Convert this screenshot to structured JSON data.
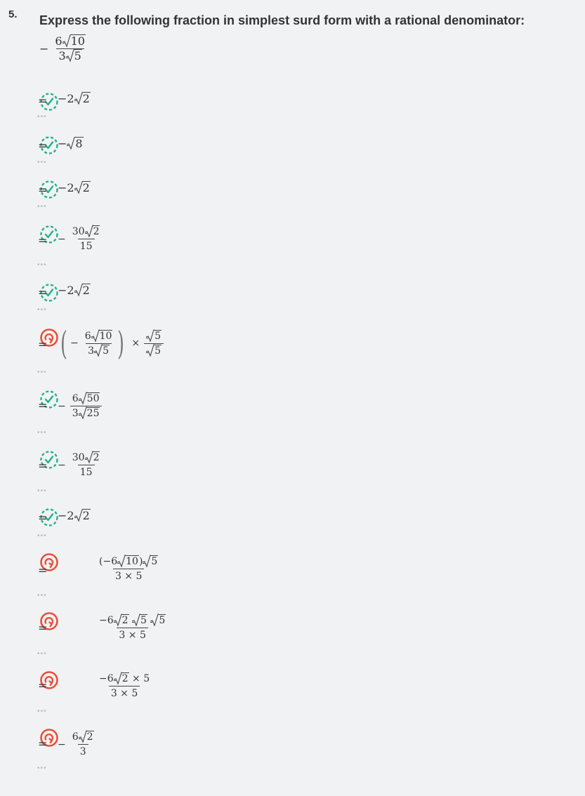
{
  "question": {
    "number": "5.",
    "prompt": "Express the following fraction in simplest surd form with a rational denominator:",
    "expression": {
      "sign": "−",
      "num_coef": "6",
      "num_rad": "10",
      "den_coef": "3",
      "den_rad": "5"
    }
  },
  "colors": {
    "correct": "#21b28c",
    "incorrect": "#e8503a",
    "background": "#f1f2f4"
  },
  "steps": [
    {
      "status": "correct",
      "icon": "check-icon",
      "expr": "= −2√2"
    },
    {
      "status": "correct",
      "icon": "check-icon",
      "expr": "= −√8"
    },
    {
      "status": "correct",
      "icon": "check-icon",
      "expr": "= −2√2"
    },
    {
      "status": "correct",
      "icon": "check-icon",
      "expr": "= − 30√2 / 15"
    },
    {
      "status": "correct",
      "icon": "check-icon",
      "expr": "= −2√2"
    },
    {
      "status": "incorrect",
      "icon": "retry-icon",
      "expr": "= ( − 6√10 / 3√5 ) × √5 / √5"
    },
    {
      "status": "correct",
      "icon": "check-icon",
      "expr": "= − 6√50 / 3√25"
    },
    {
      "status": "correct",
      "icon": "check-icon",
      "expr": "= − 30√2 / 15"
    },
    {
      "status": "correct",
      "icon": "check-icon",
      "expr": "= −2√2"
    },
    {
      "status": "incorrect",
      "icon": "retry-icon",
      "expr": "= (−6√10)√5 / 3 × 5"
    },
    {
      "status": "incorrect",
      "icon": "retry-icon",
      "expr": "= −6√2 √5 √5 / 3 × 5"
    },
    {
      "status": "incorrect",
      "icon": "retry-icon",
      "expr": "= −6√2 × 5 / 3 × 5"
    },
    {
      "status": "incorrect",
      "icon": "retry-icon",
      "expr": "= − 6√2 / 3"
    }
  ],
  "t": {
    "eq": "=",
    "minus": "−",
    "two": "2",
    "eight": "8",
    "thirty": "30",
    "fifteen": "15",
    "six": "6",
    "three": "3",
    "ten": "10",
    "five": "5",
    "fifty": "50",
    "twentyfive": "25",
    "times": "×",
    "neg2": "−2",
    "neg6": "−6",
    "lp": "(",
    "rp": ")",
    "three_times_five": "3 × 5",
    "dots": "•••"
  }
}
